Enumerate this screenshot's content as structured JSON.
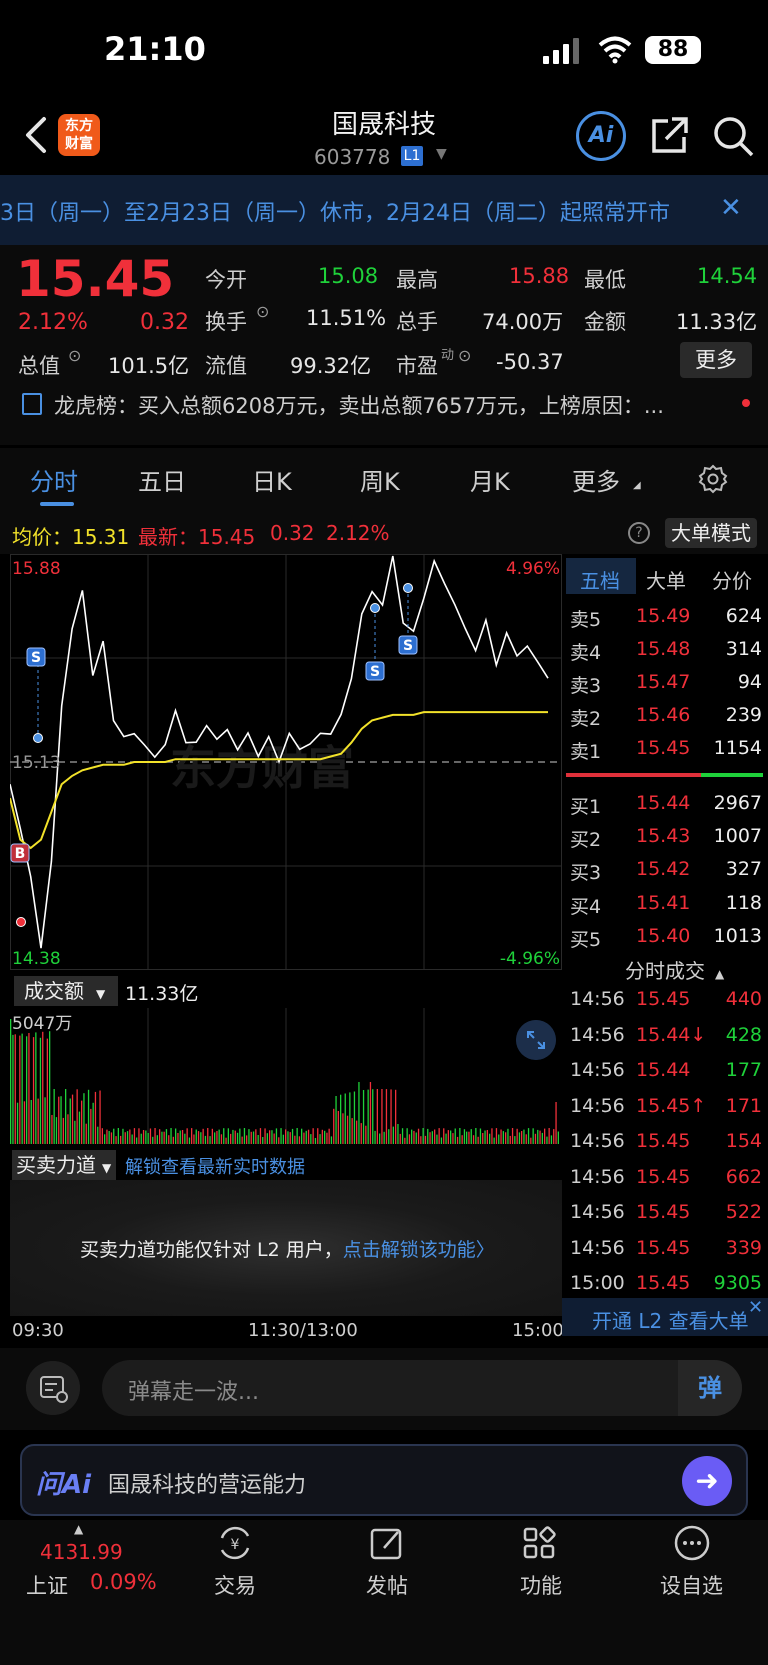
{
  "status": {
    "time": "21:10",
    "battery": "88"
  },
  "header": {
    "title": "国晟科技",
    "code": "603778",
    "level": "L1",
    "ai_label": "Ai"
  },
  "notice": {
    "text": "3日（周一）至2月23日（周一）休市，2月24日（周二）起照常开市"
  },
  "quote": {
    "price": "15.45",
    "pct": "2.12%",
    "change": "0.32",
    "items": [
      {
        "label": "今开",
        "value": "15.08",
        "color": "#1fd13a"
      },
      {
        "label": "最高",
        "value": "15.88",
        "color": "#f0303a"
      },
      {
        "label": "最低",
        "value": "14.54",
        "color": "#1fd13a"
      },
      {
        "label": "换手",
        "value": "11.51%",
        "color": "#e6e6e6"
      },
      {
        "label": "总手",
        "value": "74.00万",
        "color": "#e6e6e6"
      },
      {
        "label": "金额",
        "value": "11.33亿",
        "color": "#e6e6e6"
      },
      {
        "label": "总值",
        "value": "101.5亿",
        "color": "#e6e6e6"
      },
      {
        "label": "流值",
        "value": "99.32亿",
        "color": "#e6e6e6"
      },
      {
        "label": "市盈",
        "value": "-50.37",
        "color": "#e6e6e6"
      }
    ],
    "pe_sup": "动",
    "more_label": "更多"
  },
  "dragon": {
    "text": "龙虎榜：买入总额6208万元，卖出总额7657万元，上榜原因：..."
  },
  "tabs": [
    "分时",
    "五日",
    "日K",
    "周K",
    "月K",
    "更多"
  ],
  "chart_info": {
    "avg_label": "均价：15.31",
    "last_label": "最新：15.45",
    "change": "0.32",
    "pct": "2.12%",
    "mode_label": "大单模式",
    "help": "?"
  },
  "chart_labels": {
    "high": "15.88",
    "low": "14.38",
    "mid": "15.13",
    "high_pct": "4.96%",
    "low_pct": "-4.96%",
    "watermark": "东方财富",
    "buy_marker": "B",
    "sell_marker": "S"
  },
  "chart_data": {
    "type": "line",
    "title": "",
    "xlabel": "",
    "ylabel": "",
    "ylim": [
      14.38,
      15.88
    ],
    "x_ticks": [
      "09:30",
      "11:30/13:00",
      "15:00"
    ],
    "series": [
      {
        "name": "",
        "color": "#ffffff",
        "values": [
          15.05,
          14.9,
          14.7,
          14.48,
          14.75,
          15.35,
          15.6,
          15.75,
          15.45,
          15.55,
          15.3,
          15.2,
          15.25,
          15.18,
          15.15,
          15.2,
          15.3,
          15.22,
          15.18,
          15.28,
          15.2,
          15.25,
          15.18,
          15.22,
          15.17,
          15.2,
          15.15,
          15.22,
          15.18,
          15.2,
          15.22,
          15.25,
          15.28,
          15.45,
          15.65,
          15.75,
          15.7,
          15.88,
          15.65,
          15.58,
          15.74,
          15.84,
          15.78,
          15.7,
          15.6,
          15.55,
          15.62,
          15.5,
          15.58,
          15.52,
          15.55,
          15.48,
          15.45
        ]
      },
      {
        "name": "",
        "color": "#f2e22a",
        "values": [
          15.0,
          14.85,
          14.82,
          14.85,
          14.95,
          15.05,
          15.08,
          15.1,
          15.11,
          15.12,
          15.12,
          15.12,
          15.13,
          15.13,
          15.13,
          15.13,
          15.14,
          15.14,
          15.14,
          15.14,
          15.14,
          15.14,
          15.14,
          15.14,
          15.14,
          15.14,
          15.14,
          15.14,
          15.14,
          15.14,
          15.14,
          15.15,
          15.16,
          15.2,
          15.25,
          15.28,
          15.29,
          15.3,
          15.3,
          15.3,
          15.31,
          15.31,
          15.31,
          15.31,
          15.31,
          15.31,
          15.31,
          15.31,
          15.31,
          15.31,
          15.31,
          15.31,
          15.31
        ]
      }
    ],
    "volume_total": "11.33亿",
    "volume_max_label": "5047万"
  },
  "volume": {
    "selector": "成交额",
    "total": "11.33亿",
    "max": "5047万"
  },
  "force": {
    "selector": "买卖力道",
    "link": "解锁查看最新实时数据",
    "text": "买卖力道功能仅针对 L2 用户，",
    "cta": "点击解锁该功能〉"
  },
  "time_axis": [
    "09:30",
    "11:30/13:00",
    "15:00"
  ],
  "orderbook": {
    "tabs": [
      "五档",
      "大单",
      "分价"
    ],
    "asks": [
      {
        "label": "卖5",
        "price": "15.49",
        "vol": "624"
      },
      {
        "label": "卖4",
        "price": "15.48",
        "vol": "314"
      },
      {
        "label": "卖3",
        "price": "15.47",
        "vol": "94"
      },
      {
        "label": "卖2",
        "price": "15.46",
        "vol": "239"
      },
      {
        "label": "卖1",
        "price": "15.45",
        "vol": "1154"
      }
    ],
    "bids": [
      {
        "label": "买1",
        "price": "15.44",
        "vol": "2967"
      },
      {
        "label": "买2",
        "price": "15.43",
        "vol": "1007"
      },
      {
        "label": "买3",
        "price": "15.42",
        "vol": "327"
      },
      {
        "label": "买4",
        "price": "15.41",
        "vol": "118"
      },
      {
        "label": "买5",
        "price": "15.40",
        "vol": "1013"
      }
    ],
    "trades_title": "分时成交",
    "trades": [
      {
        "t": "14:56",
        "p": "15.45",
        "v": "440",
        "pc": "#f0303a",
        "vc": "#f0303a"
      },
      {
        "t": "14:56",
        "p": "15.44↓",
        "v": "428",
        "pc": "#f0303a",
        "vc": "#1fd13a"
      },
      {
        "t": "14:56",
        "p": "15.44",
        "v": "177",
        "pc": "#f0303a",
        "vc": "#1fd13a"
      },
      {
        "t": "14:56",
        "p": "15.45↑",
        "v": "171",
        "pc": "#f0303a",
        "vc": "#f0303a"
      },
      {
        "t": "14:56",
        "p": "15.45",
        "v": "154",
        "pc": "#f0303a",
        "vc": "#f0303a"
      },
      {
        "t": "14:56",
        "p": "15.45",
        "v": "662",
        "pc": "#f0303a",
        "vc": "#f0303a"
      },
      {
        "t": "14:56",
        "p": "15.45",
        "v": "522",
        "pc": "#f0303a",
        "vc": "#f0303a"
      },
      {
        "t": "14:56",
        "p": "15.45",
        "v": "339",
        "pc": "#f0303a",
        "vc": "#f0303a"
      },
      {
        "t": "15:00",
        "p": "15.45",
        "v": "9305",
        "pc": "#f0303a",
        "vc": "#1fd13a"
      }
    ],
    "l2_banner": "开通 L2 查看大单"
  },
  "barrage": {
    "placeholder": "弹幕走一波...",
    "button": "弹"
  },
  "askai": {
    "logo": "问Ai",
    "text": "国晟科技的营运能力"
  },
  "bottomnav": {
    "index_value": "4131.99",
    "index_name": "上证",
    "index_pct": "0.09%",
    "items": [
      "交易",
      "发帖",
      "功能",
      "设自选"
    ]
  }
}
